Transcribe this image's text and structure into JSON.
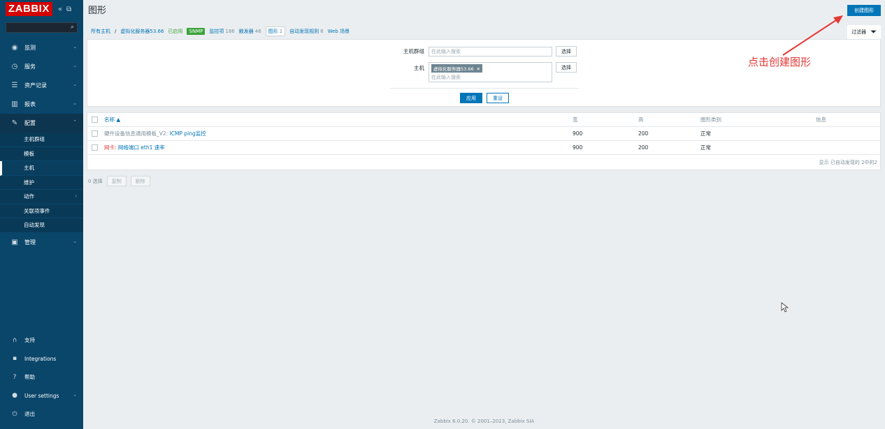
{
  "sidebar": {
    "logo": "ZABBIX",
    "collapse_icon": "«",
    "kiosk_icon": "⛶",
    "menu": [
      {
        "icon": "👁",
        "label": "监测"
      },
      {
        "icon": "◷",
        "label": "服务"
      },
      {
        "icon": "≡",
        "label": "资产记录"
      },
      {
        "icon": "▥",
        "label": "报表"
      },
      {
        "icon": "🔧",
        "label": "配置"
      }
    ],
    "submenu": [
      "主机群组",
      "模板",
      "主机",
      "维护",
      "动作",
      "关联项事件",
      "自动发现"
    ],
    "admin": {
      "icon": "⚙",
      "label": "管理"
    },
    "bottom": [
      {
        "icon": "?",
        "label": "支持"
      },
      {
        "icon": "Z",
        "label": "Integrations"
      },
      {
        "icon": "?",
        "label": "帮助"
      },
      {
        "icon": "👤",
        "label": "User settings"
      },
      {
        "icon": "⏻",
        "label": "退出"
      }
    ]
  },
  "header": {
    "title": "图形",
    "create_button": "创建图形"
  },
  "breadcrumbs": {
    "all_hosts": "所有主机",
    "sep": "/",
    "host": "虚拟化服务器53.66",
    "enabled": "已启用",
    "snmp": "SNMP",
    "items_label": "监控项",
    "items_count": "186",
    "triggers_label": "触发器",
    "triggers_count": "46",
    "graphs_label": "图形",
    "graphs_count": "2",
    "discovery_label": "自动发现规则",
    "discovery_count": "8",
    "web": "Web 场景"
  },
  "filter": {
    "tab_label": "过滤器",
    "hostgroup_label": "主机群组",
    "hostgroup_placeholder": "在此输入搜索",
    "host_label": "主机",
    "host_tag": "虚拟化服务器53.66",
    "host_placeholder": "在此输入搜索",
    "select_label": "选择",
    "apply": "应用",
    "reset": "重设"
  },
  "table": {
    "headers": {
      "name": "名称 ▲",
      "width": "宽",
      "height": "高",
      "type": "图形类别",
      "info": "信息"
    },
    "rows": [
      {
        "template": "硬件设备信息通用模板_V2:",
        "name": "ICMP ping监控",
        "width": "900",
        "height": "200",
        "type": "正常"
      },
      {
        "template": "网卡:",
        "name": "网络端口 eth1 速率",
        "width": "900",
        "height": "200",
        "type": "正常"
      }
    ],
    "footer": "显示 已自动发现的 2中的2"
  },
  "actions": {
    "selected": "0 选择",
    "copy": "复制",
    "delete": "删除"
  },
  "footer": {
    "text": "Zabbix 6.0.20. © 2001–2023,",
    "link": "Zabbix SIA"
  },
  "annotation": {
    "text": "点击创建图形",
    "color": "#e33734"
  }
}
